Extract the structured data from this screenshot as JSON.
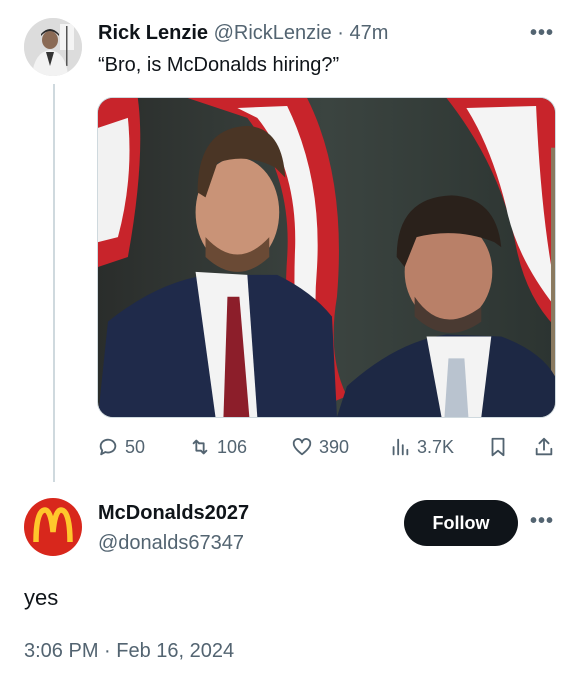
{
  "tweet": {
    "author_name": "Rick Lenzie",
    "author_handle": "@RickLenzie",
    "separator": "·",
    "time": "47m",
    "text": "“Bro, is McDonalds hiring?”",
    "more_label": "•••",
    "media_icon": "photo-two-men-in-suits-flags",
    "stats": {
      "replies": "50",
      "retweets": "106",
      "likes": "390",
      "views": "3.7K"
    }
  },
  "reply": {
    "author_name": "McDonalds2027",
    "author_handle": "@donalds67347",
    "follow_label": "Follow",
    "more_label": "•••",
    "text": "yes",
    "timestamp": "3:06 PM · Feb 16, 2024"
  },
  "colors": {
    "text": "#0f1419",
    "secondary": "#536471",
    "thread_line": "#cfd9de",
    "mcd_red": "#d8271c",
    "mcd_yellow": "#ffc72c"
  }
}
